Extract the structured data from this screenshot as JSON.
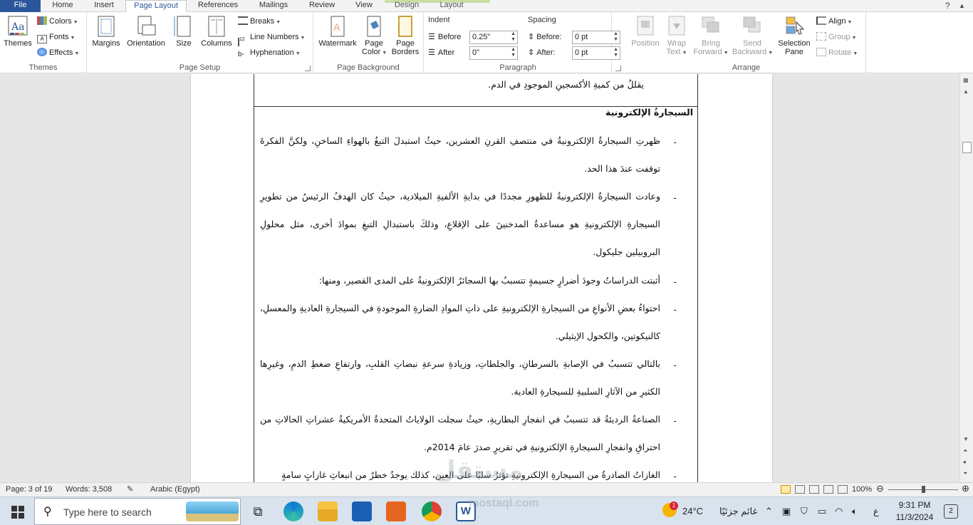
{
  "tabs": [
    "File",
    "Home",
    "Insert",
    "Page Layout",
    "References",
    "Mailings",
    "Review",
    "View",
    "Design",
    "Layout"
  ],
  "window_controls": {
    "help": "?"
  },
  "ribbon": {
    "themes": {
      "themes": "Themes",
      "colors": "Colors",
      "fonts": "Fonts",
      "effects": "Effects",
      "label": "Themes"
    },
    "page_setup": {
      "margins": "Margins",
      "orientation": "Orientation",
      "size": "Size",
      "columns": "Columns",
      "breaks": "Breaks",
      "line_numbers": "Line Numbers",
      "hyphenation": "Hyphenation",
      "label": "Page Setup"
    },
    "page_background": {
      "watermark": "Watermark",
      "page_color_1": "Page",
      "page_color_2": "Color",
      "page_borders_1": "Page",
      "page_borders_2": "Borders",
      "label": "Page Background"
    },
    "paragraph": {
      "indent_title": "Indent",
      "before_label": "Before",
      "before_value": "0.25\"",
      "after_label": "After",
      "after_value": "0\"",
      "spacing_title": "Spacing",
      "sp_before_label": "Before:",
      "sp_before_value": "0 pt",
      "sp_after_label": "After:",
      "sp_after_value": "0 pt",
      "label": "Paragraph"
    },
    "arrange": {
      "position": "Position",
      "wrap_text_1": "Wrap",
      "wrap_text_2": "Text",
      "bring_forward_1": "Bring",
      "bring_forward_2": "Forward",
      "send_backward_1": "Send",
      "send_backward_2": "Backward",
      "selection_pane_1": "Selection",
      "selection_pane_2": "Pane",
      "align": "Align",
      "group": "Group",
      "rotate": "Rotate",
      "label": "Arrange"
    }
  },
  "document": {
    "top_line": "يقللُ من كميةِ الأكسجينِ الموجودِ في الدم.",
    "heading": "السيجارةُ الإلكترونية",
    "paragraphs": [
      "ظهرتِ السيجارةُ الإلكترونيةُ في منتصفِ القرنِ العشرين، حيثُ استبدلَ التبغُ بالهواءِ الساخنِ، ولكنَّ الفكرةَ توقفت عندَ هذا الحد.",
      "وعادت السيجارةُ الإلكترونيةُ للظهورِ مجددًا في بدايةِ الألفيةِ الميلادية، حيثُ كان الهدفُ الرئيسُ من تطويرِ السيجارةِ الإلكترونيةِ هو مساعدةُ المدخنينَ على الإقلاعِ، وذلكَ باستبدالِ التبغِ بموادَ أخرى، مثل محلولِ البروبيلين جليكول.",
      "أثبتت الدراساتُ وجودَ أضرارٍ جسيمةٍ تتسببُ بها السجائرُ الإلكترونيةُ على المدى القصير، ومنها:",
      "احتواءُ بعضِ الأنواعِ من السيجارةِ الإلكترونيةِ على ذاتِ الموادِ الضارةِ الموجودةِ في السيجارةِ العاديةِ والمعسلِ، كالنيكوتين، والكحول الإيثيلي.",
      "بالتالي تتسببُ في الإصابةِ بالسرطانِ، والجلطاتِ، وزيادةِ سرعةِ نبضاتِ القلبِ، وارتفاعِ ضغطِ الدمِ، وغيرِها الكثيرِ من الآثارِ السلبيةِ للسيجارةِ العادية.",
      "الصناعةُ الرديئةُ قد تتسببُ في انفجارِ البطاريةِ، حيثُ سجلت الولاياتُ المتحدةُ الأمريكيةُ عشراتِ الحالاتِ من احتراقِ وانفجارِ السيجارةِ الإلكترونيةِ في تقريرٍ صدرَ عامَ 2014م.",
      "الغازاتُ الصادرةُ من السيجارةِ الإلكترونيةِ تؤثرُ سلبًا على العين، كذلك يوجدُ خطرٌ من انبعاثِ غازاتٍ سامةٍ"
    ]
  },
  "status": {
    "page": "Page: 3 of 19",
    "words": "Words: 3,508",
    "language": "Arabic (Egypt)",
    "zoom": "100%",
    "zoom_level": 1.0
  },
  "taskbar": {
    "search_placeholder": "Type here to search",
    "weather_badge": "1",
    "temperature": "24°C",
    "weather_text": "غائم جزئيًا",
    "lang": "ع",
    "time": "9:31 PM",
    "date": "11/3/2024",
    "notifications": "2"
  },
  "watermark": {
    "text": "مستقل",
    "sub": "mostaql.com"
  },
  "colors": {
    "accent": "#2b579a",
    "context_band": "#c9dfa6"
  }
}
